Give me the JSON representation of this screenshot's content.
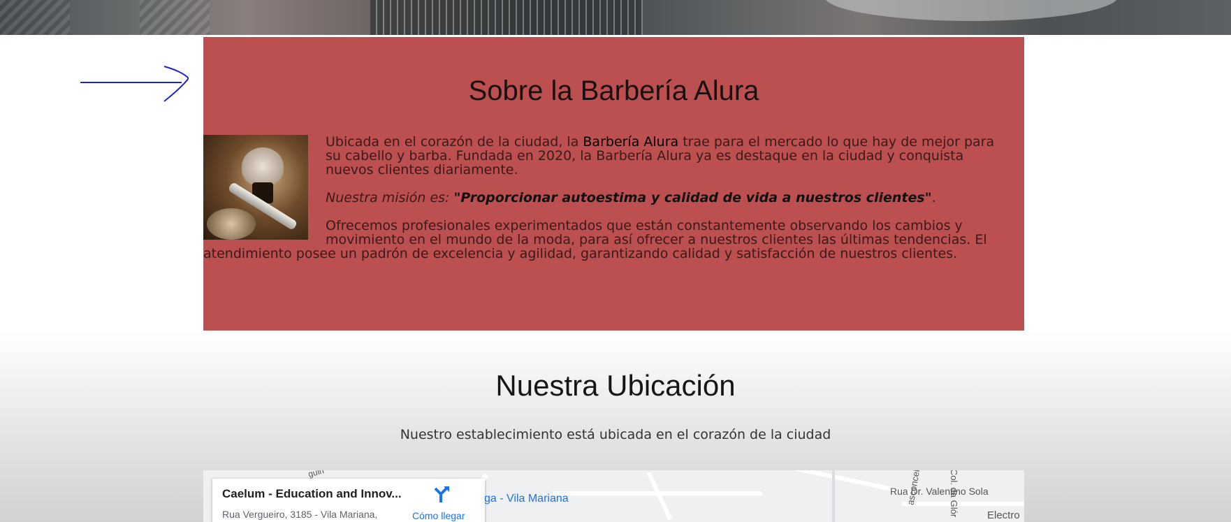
{
  "about": {
    "title": "Sobre la Barbería Alura",
    "p1_pre": "Ubicada en el corazón de la ciudad, la ",
    "p1_bold": "Barbería Alura",
    "p1_post": " trae para el mercado lo que hay de mejor para su cabello y barba. Fundada en 2020, la Barbería Alura ya es destaque en la ciudad y conquista nuevos clientes diariamente.",
    "mission_label": "Nuestra misión es: ",
    "mission_quote": "\"Proporcionar autoestima y calidad de vida a nuestros clientes\"",
    "mission_end": ".",
    "p3": "Ofrecemos profesionales experimentados que están constantemente observando los cambios y movimiento en el mundo de la moda, para así ofrecer a nuestros clientes las últimas tendencias. El atendimiento posee un padrón de excelencia y agilidad, garantizando calidad y satisfacción de nuestros clientes."
  },
  "location": {
    "title": "Nuestra Ubicación",
    "subtitle": "Nuestro establecimiento está ubicada en el corazón de la ciudad"
  },
  "map": {
    "place_name": "Caelum - Education and Innov...",
    "address": "Rua Vergueiro, 3185 - Vila Mariana,",
    "directions_label": "Cómo llegar",
    "area_label": "ga - Vila Mariana",
    "street_1": "Rua Dr. Valentino Sola",
    "street_2": "Col. da Glór",
    "street_3": "asconcelos",
    "street_4": "Electro",
    "street_5": "guin",
    "colors": {
      "card_accent": "#1a73e8",
      "about_bg": "#bc4f4f"
    }
  }
}
